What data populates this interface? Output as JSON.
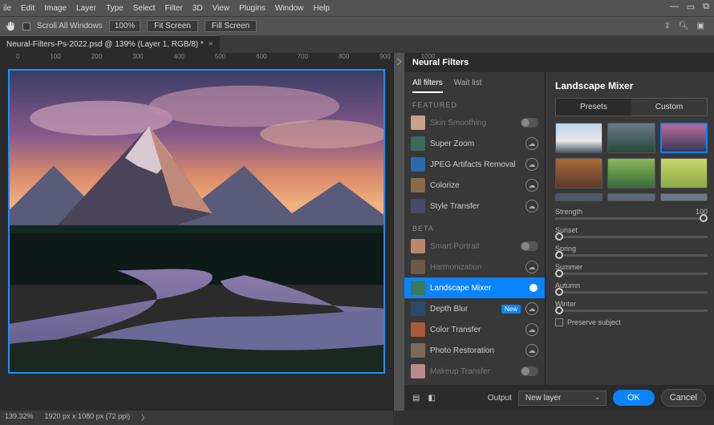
{
  "menubar": [
    "ile",
    "Edit",
    "Image",
    "Layer",
    "Type",
    "Select",
    "Filter",
    "3D",
    "View",
    "Plugins",
    "Window",
    "Help"
  ],
  "optbar": {
    "scroll_all": "Scroll All Windows",
    "zoom": "100%",
    "fit": "Fit Screen",
    "fill": "Fill Screen"
  },
  "doc_tab": {
    "title": "Neural-Filters-Ps-2022.psd @ 139% (Layer 1, RGB/8) *"
  },
  "ruler": [
    "0",
    "100",
    "200",
    "300",
    "400",
    "500",
    "600",
    "700",
    "800",
    "900",
    "1000"
  ],
  "panel": {
    "title": "Neural Filters",
    "tabs": {
      "all": "All filters",
      "wait": "Wait list"
    },
    "featured_label": "FEATURED",
    "beta_label": "BETA",
    "featured": [
      {
        "name": "Skin Smoothing",
        "state": "disabled",
        "ctl": "toggle-off"
      },
      {
        "name": "Super Zoom",
        "state": "off",
        "ctl": "download"
      },
      {
        "name": "JPEG Artifacts Removal",
        "state": "off",
        "ctl": "download"
      },
      {
        "name": "Colorize",
        "state": "off",
        "ctl": "download"
      },
      {
        "name": "Style Transfer",
        "state": "off",
        "ctl": "download"
      }
    ],
    "beta": [
      {
        "name": "Smart Portrait",
        "state": "disabled",
        "ctl": "toggle-off"
      },
      {
        "name": "Harmonization",
        "state": "disabled",
        "ctl": "download"
      },
      {
        "name": "Landscape Mixer",
        "state": "selected",
        "ctl": "toggle-on"
      },
      {
        "name": "Depth Blur",
        "state": "off",
        "ctl": "download",
        "badge": "New"
      },
      {
        "name": "Color Transfer",
        "state": "off",
        "ctl": "download"
      },
      {
        "name": "Photo Restoration",
        "state": "off",
        "ctl": "download"
      },
      {
        "name": "Makeup Transfer",
        "state": "disabled",
        "ctl": "toggle-off"
      }
    ]
  },
  "settings": {
    "title": "Landscape Mixer",
    "preset_tabs": {
      "presets": "Presets",
      "custom": "Custom"
    },
    "strength": {
      "label": "Strength",
      "value": "100"
    },
    "sliders": [
      {
        "label": "Sunset",
        "value": 0
      },
      {
        "label": "Spring",
        "value": 0
      },
      {
        "label": "Summer",
        "value": 0
      },
      {
        "label": "Autumn",
        "value": 0
      },
      {
        "label": "Winter",
        "value": 0
      }
    ],
    "preserve": "Preserve subject"
  },
  "bottom": {
    "output_label": "Output",
    "output_value": "New layer",
    "ok": "OK",
    "cancel": "Cancel"
  },
  "status": {
    "zoom": "139.32%",
    "dims": "1920 px x 1080 px (72 ppi)"
  }
}
